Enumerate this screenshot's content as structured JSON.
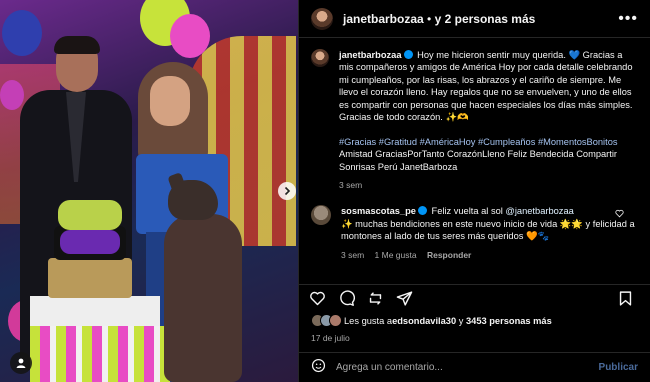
{
  "header": {
    "username": "janetbarbozaa",
    "others": "y 2 personas más",
    "joiner": "•"
  },
  "caption": {
    "username": "janetbarbozaa",
    "text": "Hoy me hicieron sentir muy querida. 💙 Gracias a mis compañeros y amigos de América Hoy por cada detalle celebrando mi cumpleaños, por las risas, los abrazos y el cariño de siempre. Me llevo el corazón lleno. Hay regalos que no se envuelven, y uno de ellos es compartir con personas que hacen especiales los días más simples. Gracias de todo corazón. ✨🫶",
    "hashtags": "#Gracias #Gratitud #AméricaHoy #Cumpleaños #MomentosBonitos",
    "tail": " Amistad GraciasPorTanto CorazónLleno Feliz Bendecida Compartir Sonrisas Perú JanetBarboza",
    "time": "3 sem"
  },
  "comment": {
    "username": "sosmascotas_pe",
    "text_before": "Feliz vuelta al sol ",
    "mention": "@janetbarbozaa",
    "text_after": "✨ muchas bendiciones en este nuevo inicio de vida 🌟🌟 y felicidad a montones al lado de tus seres más queridos 🧡🐾",
    "time": "3 sem",
    "likes": "1 Me gusta",
    "reply": "Responder"
  },
  "likes": {
    "prefix": "Les gusta a ",
    "user": "edsondavila30",
    "suffix": " y ",
    "count": "3453 personas más"
  },
  "date": "17 de julio",
  "composer": {
    "placeholder": "Agrega un comentario...",
    "publish": "Publicar"
  },
  "icons": [
    "more-options-icon",
    "heart-icon",
    "comment-icon",
    "share-icon",
    "send-icon",
    "bookmark-icon",
    "emoji-icon",
    "user-tag-icon",
    "next-arrow-icon",
    "close-icon"
  ],
  "colors": {
    "background": "#000000",
    "hashtag": "#a5c3f0",
    "verified": "#0095f6",
    "muted": "#a8a8a8"
  }
}
